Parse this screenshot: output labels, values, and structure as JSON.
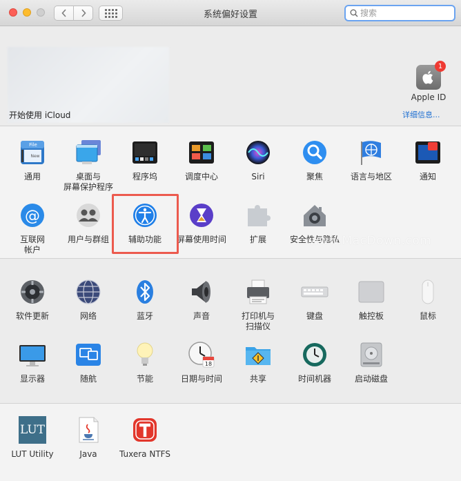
{
  "window": {
    "title": "系统偏好设置"
  },
  "search": {
    "placeholder": "搜索"
  },
  "account": {
    "apple_id_label": "Apple ID",
    "badge": "1"
  },
  "icloud": {
    "prompt": "开始使用 iCloud",
    "details": "详细信息..."
  },
  "row1": [
    {
      "label": "通用",
      "icon": "general-icon"
    },
    {
      "label": "桌面与\n屏幕保护程序",
      "icon": "desktop-screensaver-icon"
    },
    {
      "label": "程序坞",
      "icon": "dock-icon"
    },
    {
      "label": "调度中心",
      "icon": "mission-control-icon"
    },
    {
      "label": "Siri",
      "icon": "siri-icon"
    },
    {
      "label": "聚焦",
      "icon": "spotlight-icon"
    },
    {
      "label": "语言与地区",
      "icon": "language-region-icon"
    },
    {
      "label": "通知",
      "icon": "notifications-icon"
    }
  ],
  "row2": [
    {
      "label": "互联网\n帐户",
      "icon": "internet-accounts-icon"
    },
    {
      "label": "用户与群组",
      "icon": "users-groups-icon"
    },
    {
      "label": "辅助功能",
      "icon": "accessibility-icon"
    },
    {
      "label": "屏幕使用时间",
      "icon": "screen-time-icon"
    },
    {
      "label": "扩展",
      "icon": "extensions-icon"
    },
    {
      "label": "安全性与隐私",
      "icon": "security-privacy-icon"
    }
  ],
  "row3": [
    {
      "label": "软件更新",
      "icon": "software-update-icon"
    },
    {
      "label": "网络",
      "icon": "network-icon"
    },
    {
      "label": "蓝牙",
      "icon": "bluetooth-icon"
    },
    {
      "label": "声音",
      "icon": "sound-icon"
    },
    {
      "label": "打印机与\n扫描仪",
      "icon": "printers-scanners-icon"
    },
    {
      "label": "键盘",
      "icon": "keyboard-icon"
    },
    {
      "label": "触控板",
      "icon": "trackpad-icon"
    },
    {
      "label": "鼠标",
      "icon": "mouse-icon"
    }
  ],
  "row4": [
    {
      "label": "显示器",
      "icon": "displays-icon"
    },
    {
      "label": "随航",
      "icon": "sidecar-icon"
    },
    {
      "label": "节能",
      "icon": "energy-saver-icon"
    },
    {
      "label": "日期与时间",
      "icon": "date-time-icon"
    },
    {
      "label": "共享",
      "icon": "sharing-icon"
    },
    {
      "label": "时间机器",
      "icon": "time-machine-icon"
    },
    {
      "label": "启动磁盘",
      "icon": "startup-disk-icon"
    }
  ],
  "row5": [
    {
      "label": "LUT Utility",
      "icon": "lut-utility-icon",
      "icon_text": "LUT"
    },
    {
      "label": "Java",
      "icon": "java-icon"
    },
    {
      "label": "Tuxera NTFS",
      "icon": "tuxera-ntfs-icon"
    }
  ],
  "watermark": "www.MacDown.com",
  "colors": {
    "highlight": "#ec5a4e",
    "accent": "#1f6fd1",
    "badge": "#ef3a32"
  }
}
